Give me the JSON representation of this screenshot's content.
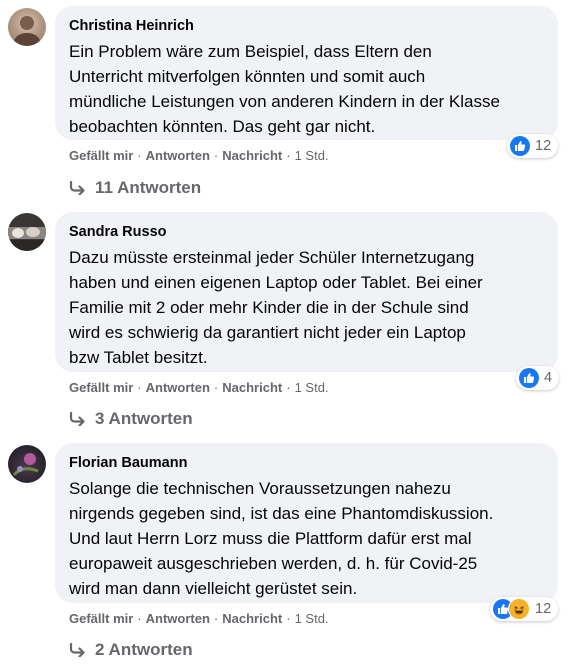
{
  "colors": {
    "bubble_bg": "#f0f2f5",
    "meta_text": "#65676b",
    "like_blue": "#1877f2",
    "haha_yellow": "#f7b125"
  },
  "comments": [
    {
      "author": "Christina Heinrich",
      "lines": [
        "Ein Problem wäre zum Beispiel, dass Eltern den",
        "Unterricht mitverfolgen könnten und somit auch",
        "mündliche Leistungen von anderen Kindern in der Klasse",
        "beobachten könnten. Das geht gar nicht."
      ],
      "actions": {
        "like": "Gefällt mir",
        "reply": "Antworten",
        "message": "Nachricht",
        "time": "1 Std."
      },
      "reaction_icons": [
        "like-icon"
      ],
      "reaction_count": "12",
      "replies": "11 Antworten"
    },
    {
      "author": "Sandra Russo",
      "lines": [
        "Dazu müsste ersteinmal jeder Schüler Internetzugang",
        "haben und einen eigenen Laptop oder Tablet. Bei einer",
        "Familie mit 2 oder mehr Kinder die in der Schule sind",
        "wird es schwierig da garantiert nicht jeder ein Laptop",
        "bzw Tablet besitzt."
      ],
      "actions": {
        "like": "Gefällt mir",
        "reply": "Antworten",
        "message": "Nachricht",
        "time": "1 Std."
      },
      "reaction_icons": [
        "like-icon"
      ],
      "reaction_count": "4",
      "replies": "3 Antworten"
    },
    {
      "author": "Florian Baumann",
      "lines": [
        "Solange die technischen Voraussetzungen nahezu",
        "nirgends gegeben sind, ist das eine Phantomdiskussion.",
        "Und laut Herrn Lorz muss die Plattform dafür erst mal",
        "europaweit ausgeschrieben werden, d. h. für Covid-25",
        "wird man dann vielleicht gerüstet sein."
      ],
      "actions": {
        "like": "Gefällt mir",
        "reply": "Antworten",
        "message": "Nachricht",
        "time": "1 Std."
      },
      "reaction_icons": [
        "like-icon",
        "haha-icon"
      ],
      "reaction_count": "12",
      "replies": "2 Antworten"
    }
  ]
}
